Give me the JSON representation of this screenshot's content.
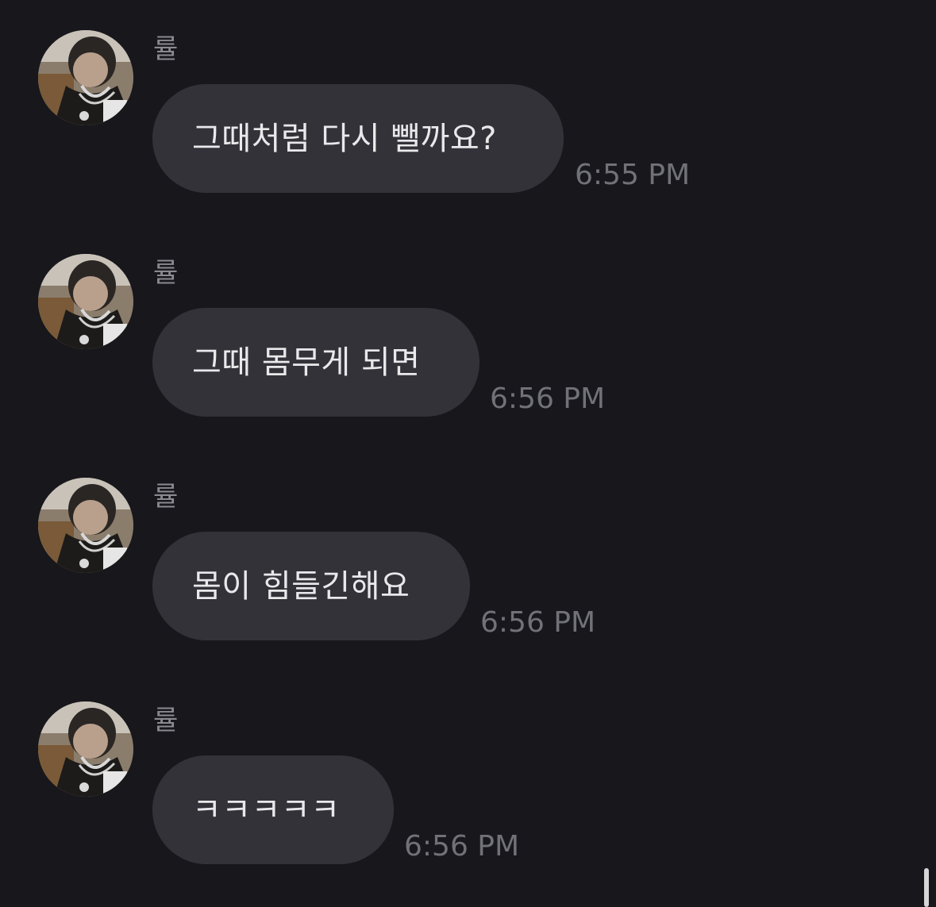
{
  "messages": [
    {
      "sender": "률",
      "text": "그때처럼 다시 뺄까요?",
      "time": "6:55 PM"
    },
    {
      "sender": "률",
      "text": "그때 몸무게 되면",
      "time": "6:56 PM"
    },
    {
      "sender": "률",
      "text": "몸이 힘들긴해요",
      "time": "6:56 PM"
    },
    {
      "sender": "률",
      "text": "ㅋㅋㅋㅋㅋ",
      "time": "6:56 PM"
    }
  ],
  "colors": {
    "background": "#17171c",
    "bubble": "#323238",
    "text": "#e9e9ec",
    "meta": "#717178"
  },
  "icons": {
    "avatar": "profile-photo",
    "scrollbar": "scroll-thumb"
  }
}
